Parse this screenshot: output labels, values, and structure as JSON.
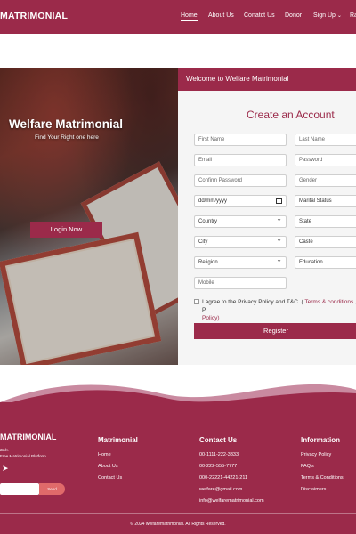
{
  "brand": "MATRIMONIAL",
  "nav": [
    {
      "label": "Home",
      "active": true
    },
    {
      "label": "About Us"
    },
    {
      "label": "Conatct Us"
    },
    {
      "label": "Donor"
    },
    {
      "label": "Sign Up",
      "caret": "chevron-down-icon"
    },
    {
      "label": "Ra"
    }
  ],
  "hero": {
    "title": "Welfare Matrimonial",
    "subtitle": "Find Your Right one here",
    "button": "Login Now"
  },
  "form": {
    "welcome": "Welcome to Welfare Matrimonial",
    "title": "Create an Account",
    "first_name": "First Name",
    "last_name": "Last Name",
    "email": "Email",
    "password": "Password",
    "confirm_password": "Confirm Password",
    "gender": "Gender",
    "dob": "dd/mm/yyyy",
    "marital_status": "Marital Status",
    "country": "Country",
    "state": "State",
    "city": "City",
    "caste": "Caste",
    "religion": "Religion",
    "education": "Education",
    "mobile": "Mobile",
    "terms_prefix": "I agree to the Privacy Policy and T&C. ( ",
    "terms_link": "Terms & conditions",
    "terms_sep": " , P",
    "terms_line2": "Policy)",
    "register": "Register"
  },
  "footer": {
    "brand": "MATRIMONIAL",
    "tagline1": "atch.",
    "tagline2": "Free Matrimonial Platform",
    "subscribe_placeholder": "",
    "subscribe_button": "Send",
    "col1": {
      "title": "Matrimonial",
      "links": [
        "Home",
        "About Us",
        "Contact Us"
      ]
    },
    "col2": {
      "title": "Contact Us",
      "links": [
        "00-1111-222-3333",
        "00-222-555-7777",
        "000-22221-44221-211",
        "welfare@gmail.com",
        "info@welfarematrimonial.com"
      ]
    },
    "col3": {
      "title": "Information",
      "links": [
        "Privacy Policy",
        "FAQ's",
        "Terms & Conditions",
        "Disclaimers"
      ]
    },
    "copyright": "© 2024 welfarematrimonial. All Rights Reserved."
  },
  "colors": {
    "brand": "#9b2a4a",
    "accent": "#e06a6a"
  }
}
